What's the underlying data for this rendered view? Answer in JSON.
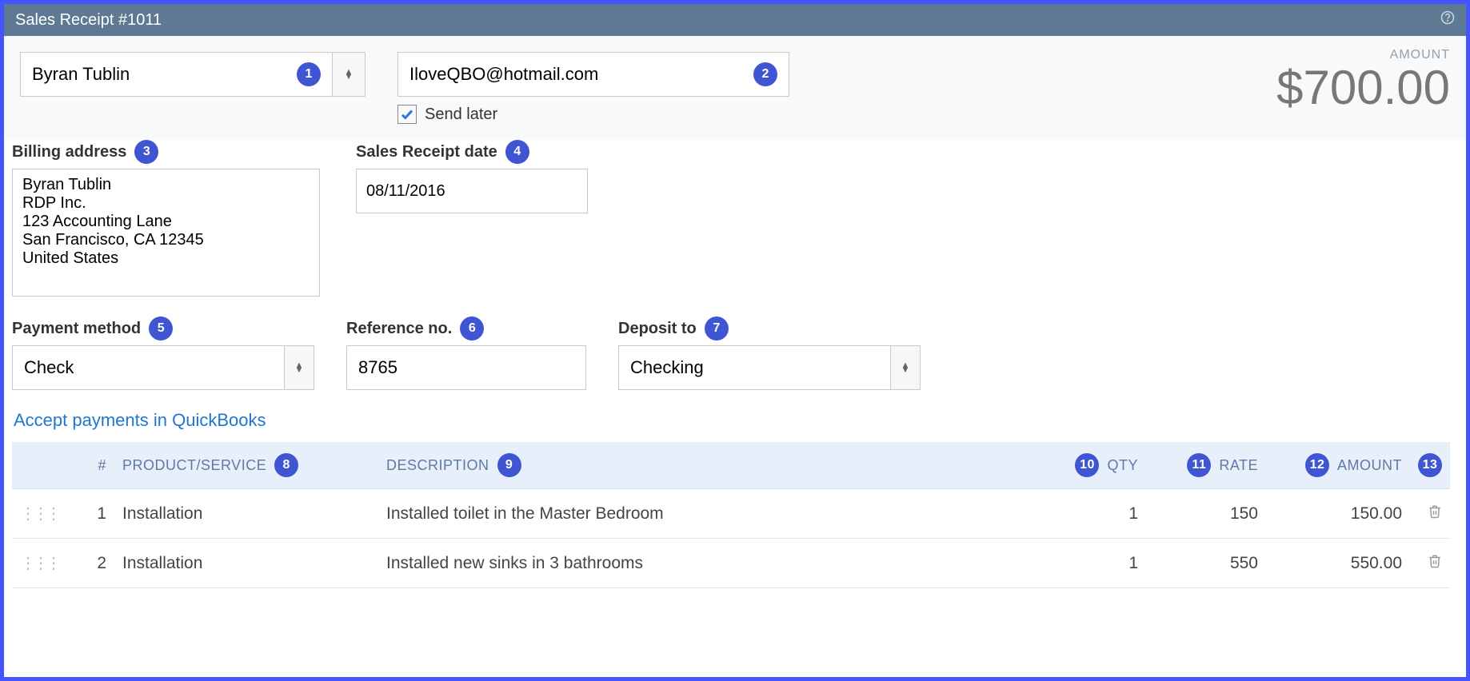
{
  "titlebar": {
    "title": "Sales Receipt #1011"
  },
  "customer": {
    "name": "Byran Tublin"
  },
  "email": {
    "value": "IloveQBO@hotmail.com"
  },
  "sendLater": {
    "label": "Send later",
    "checked": true
  },
  "amount": {
    "label": "AMOUNT",
    "value": "$700.00"
  },
  "billing": {
    "label": "Billing address",
    "text": "Byran Tublin\nRDP Inc.\n123 Accounting Lane\nSan Francisco, CA  12345\nUnited States"
  },
  "receiptDate": {
    "label": "Sales Receipt date",
    "value": "08/11/2016"
  },
  "paymentMethod": {
    "label": "Payment method",
    "value": "Check"
  },
  "reference": {
    "label": "Reference no.",
    "value": "8765"
  },
  "deposit": {
    "label": "Deposit to",
    "value": "Checking"
  },
  "acceptLink": "Accept payments in QuickBooks",
  "columns": {
    "num": "#",
    "product": "PRODUCT/SERVICE",
    "desc": "DESCRIPTION",
    "qty": "QTY",
    "rate": "RATE",
    "amount": "AMOUNT"
  },
  "rows": [
    {
      "n": "1",
      "product": "Installation",
      "desc": "Installed toilet in the Master Bedroom",
      "qty": "1",
      "rate": "150",
      "amount": "150.00"
    },
    {
      "n": "2",
      "product": "Installation",
      "desc": "Installed new sinks in 3 bathrooms",
      "qty": "1",
      "rate": "550",
      "amount": "550.00"
    }
  ],
  "badges": {
    "b1": "1",
    "b2": "2",
    "b3": "3",
    "b4": "4",
    "b5": "5",
    "b6": "6",
    "b7": "7",
    "b8": "8",
    "b9": "9",
    "b10": "10",
    "b11": "11",
    "b12": "12",
    "b13": "13"
  }
}
